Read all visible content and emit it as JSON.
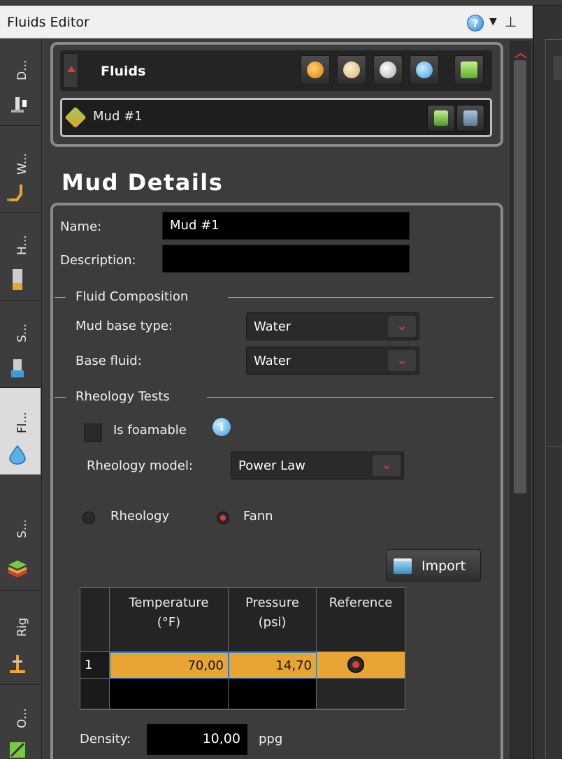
{
  "window": {
    "title": "Fluids Editor"
  },
  "side_tabs": [
    {
      "label": "D...",
      "icon": "drill-tower-icon"
    },
    {
      "label": "W...",
      "icon": "well-path-icon"
    },
    {
      "label": "H...",
      "icon": "hole-section-icon"
    },
    {
      "label": "S...",
      "icon": "string-icon"
    },
    {
      "label": "Fl...",
      "icon": "fluid-drop-icon",
      "active": true
    },
    {
      "label": "S...",
      "icon": "subsurface-layers-icon"
    },
    {
      "label": "Rig",
      "icon": "rig-icon"
    },
    {
      "label": "O...",
      "icon": "other-icon"
    }
  ],
  "fluids": {
    "header": "Fluids",
    "items": [
      {
        "name": "Mud #1"
      }
    ],
    "buttons": [
      "add-orange-fluid-icon",
      "add-cream-fluid-icon",
      "add-white-fluid-icon",
      "add-blue-fluid-icon",
      "copy-fluid-icon"
    ]
  },
  "details": {
    "title": "Mud Details",
    "name_label": "Name:",
    "name_value": "Mud #1",
    "description_label": "Description:",
    "description_value": "",
    "composition": {
      "section_label": "Fluid Composition",
      "base_type_label": "Mud base type:",
      "base_type_value": "Water",
      "base_fluid_label": "Base fluid:",
      "base_fluid_value": "Water"
    },
    "rheology": {
      "section_label": "Rheology Tests",
      "foamable_label": "Is foamable",
      "foamable_checked": false,
      "model_label": "Rheology model:",
      "model_value": "Power Law",
      "radio_rheology": "Rheology",
      "radio_fann": "Fann",
      "selected": "Fann",
      "import_label": "Import",
      "table": {
        "headers": [
          "Temperature\n(°F)",
          "Pressure\n(psi)",
          "Reference"
        ],
        "rows": [
          {
            "num": "1",
            "temperature": "70,00",
            "pressure": "14,70",
            "reference": true
          }
        ]
      }
    },
    "density_label": "Density:",
    "density_value": "10,00",
    "density_unit": "ppg"
  },
  "colors": {
    "accent": "#e8a534",
    "arrow": "#e03a3a",
    "panel": "#3c3c3c"
  }
}
